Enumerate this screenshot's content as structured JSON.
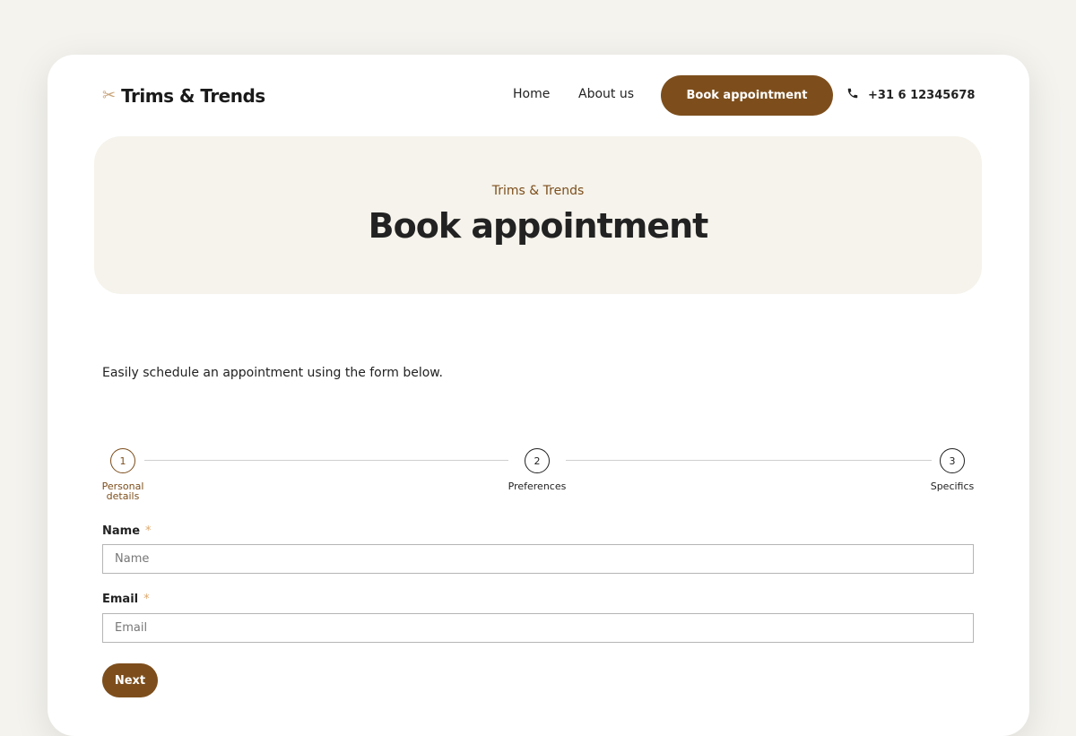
{
  "header": {
    "logo_icon": "scissors-icon",
    "logo_text": "Trims & Trends",
    "nav": [
      {
        "label": "Home"
      },
      {
        "label": "About us"
      }
    ],
    "book_button": "Book appointment",
    "phone_icon": "phone-icon",
    "phone": "+31 6 12345678"
  },
  "hero": {
    "subtitle": "Trims & Trends",
    "title": "Book appointment"
  },
  "intro": "Easily schedule an appointment using the form below.",
  "steps": [
    {
      "number": "1",
      "label_line1": "Personal",
      "label_line2": "details",
      "active": true
    },
    {
      "number": "2",
      "label_line1": "Preferences",
      "label_line2": "",
      "active": false
    },
    {
      "number": "3",
      "label_line1": "Specifics",
      "label_line2": "",
      "active": false
    }
  ],
  "form": {
    "name": {
      "label": "Name",
      "required_mark": "*",
      "placeholder": "Name",
      "value": ""
    },
    "email": {
      "label": "Email",
      "required_mark": "*",
      "placeholder": "Email",
      "value": ""
    },
    "next_button": "Next"
  },
  "colors": {
    "accent": "#7d4e1c",
    "background": "#f4f3ee",
    "hero_background": "#f5f3eb",
    "required_mark": "#e0a96d"
  }
}
